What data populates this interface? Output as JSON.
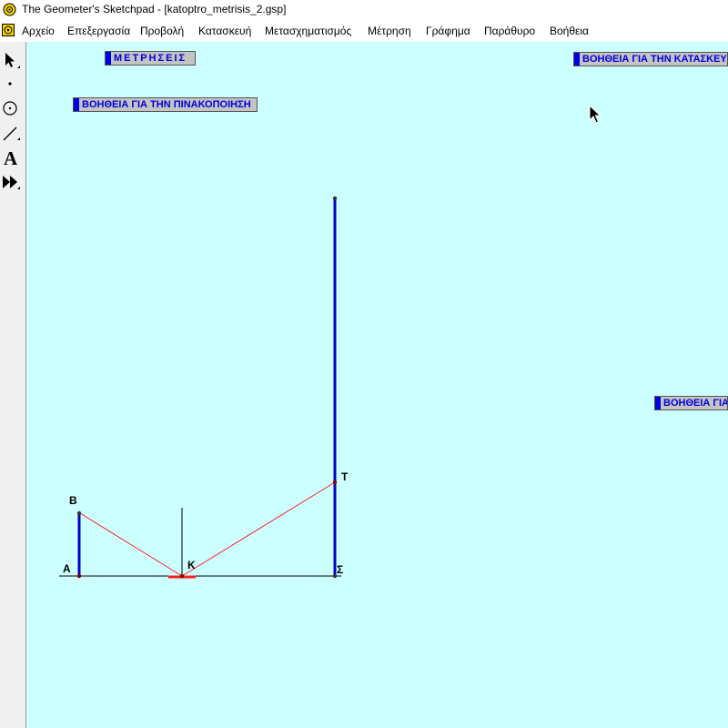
{
  "window": {
    "title": "The Geometer's Sketchpad - [katoptro_metrisis_2.gsp]"
  },
  "menu": [
    "Αρχείο",
    "Επεξεργασία",
    "Προβολή",
    "Κατασκευή",
    "Μετασχηματισμός",
    "Μέτρηση",
    "Γράφημα",
    "Παράθυρο",
    "Βοήθεια"
  ],
  "toolbox": [
    {
      "name": "selection-arrow-tool"
    },
    {
      "name": "point-tool"
    },
    {
      "name": "compass-tool"
    },
    {
      "name": "straightedge-tool"
    },
    {
      "name": "text-tool",
      "glyph": "A"
    },
    {
      "name": "custom-tool"
    }
  ],
  "buttons": {
    "measurements": "ΜΕΤΡΗΣΕΙΣ",
    "help_tabulation": "ΒΟΗΘΕΙΑ ΓΙΑ ΤΗΝ ΠΙΝΑΚΟΠΟΙΗΣΗ",
    "help_construction": "ΒΟΗΘΕΙΑ ΓΙΑ ΤΗΝ ΚΑΤΑΣΚΕΥ",
    "help_other": "ΒΟΗΘΕΙΑ ΓΙΑ"
  },
  "points": {
    "A": "Α",
    "B": "Β",
    "K": "Κ",
    "T": "Τ",
    "S": "Σ"
  },
  "colors": {
    "canvas": "#ccffff",
    "segment": "#0000cc",
    "ray": "#ff2020",
    "button_text": "#0000dd"
  }
}
